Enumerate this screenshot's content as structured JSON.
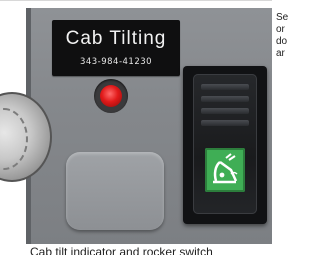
{
  "photo": {
    "label_title": "Cab Tilting",
    "label_number": "343-984-41230",
    "indicator_color": "#e11a1a",
    "switch_symbol_color": "#3fae55",
    "switch_icon": "cab-tilt-icon"
  },
  "sidebar": {
    "text": "Se\nor\ndo\nar"
  },
  "caption": {
    "text": "Cab tilt indicator and rocker switch"
  }
}
